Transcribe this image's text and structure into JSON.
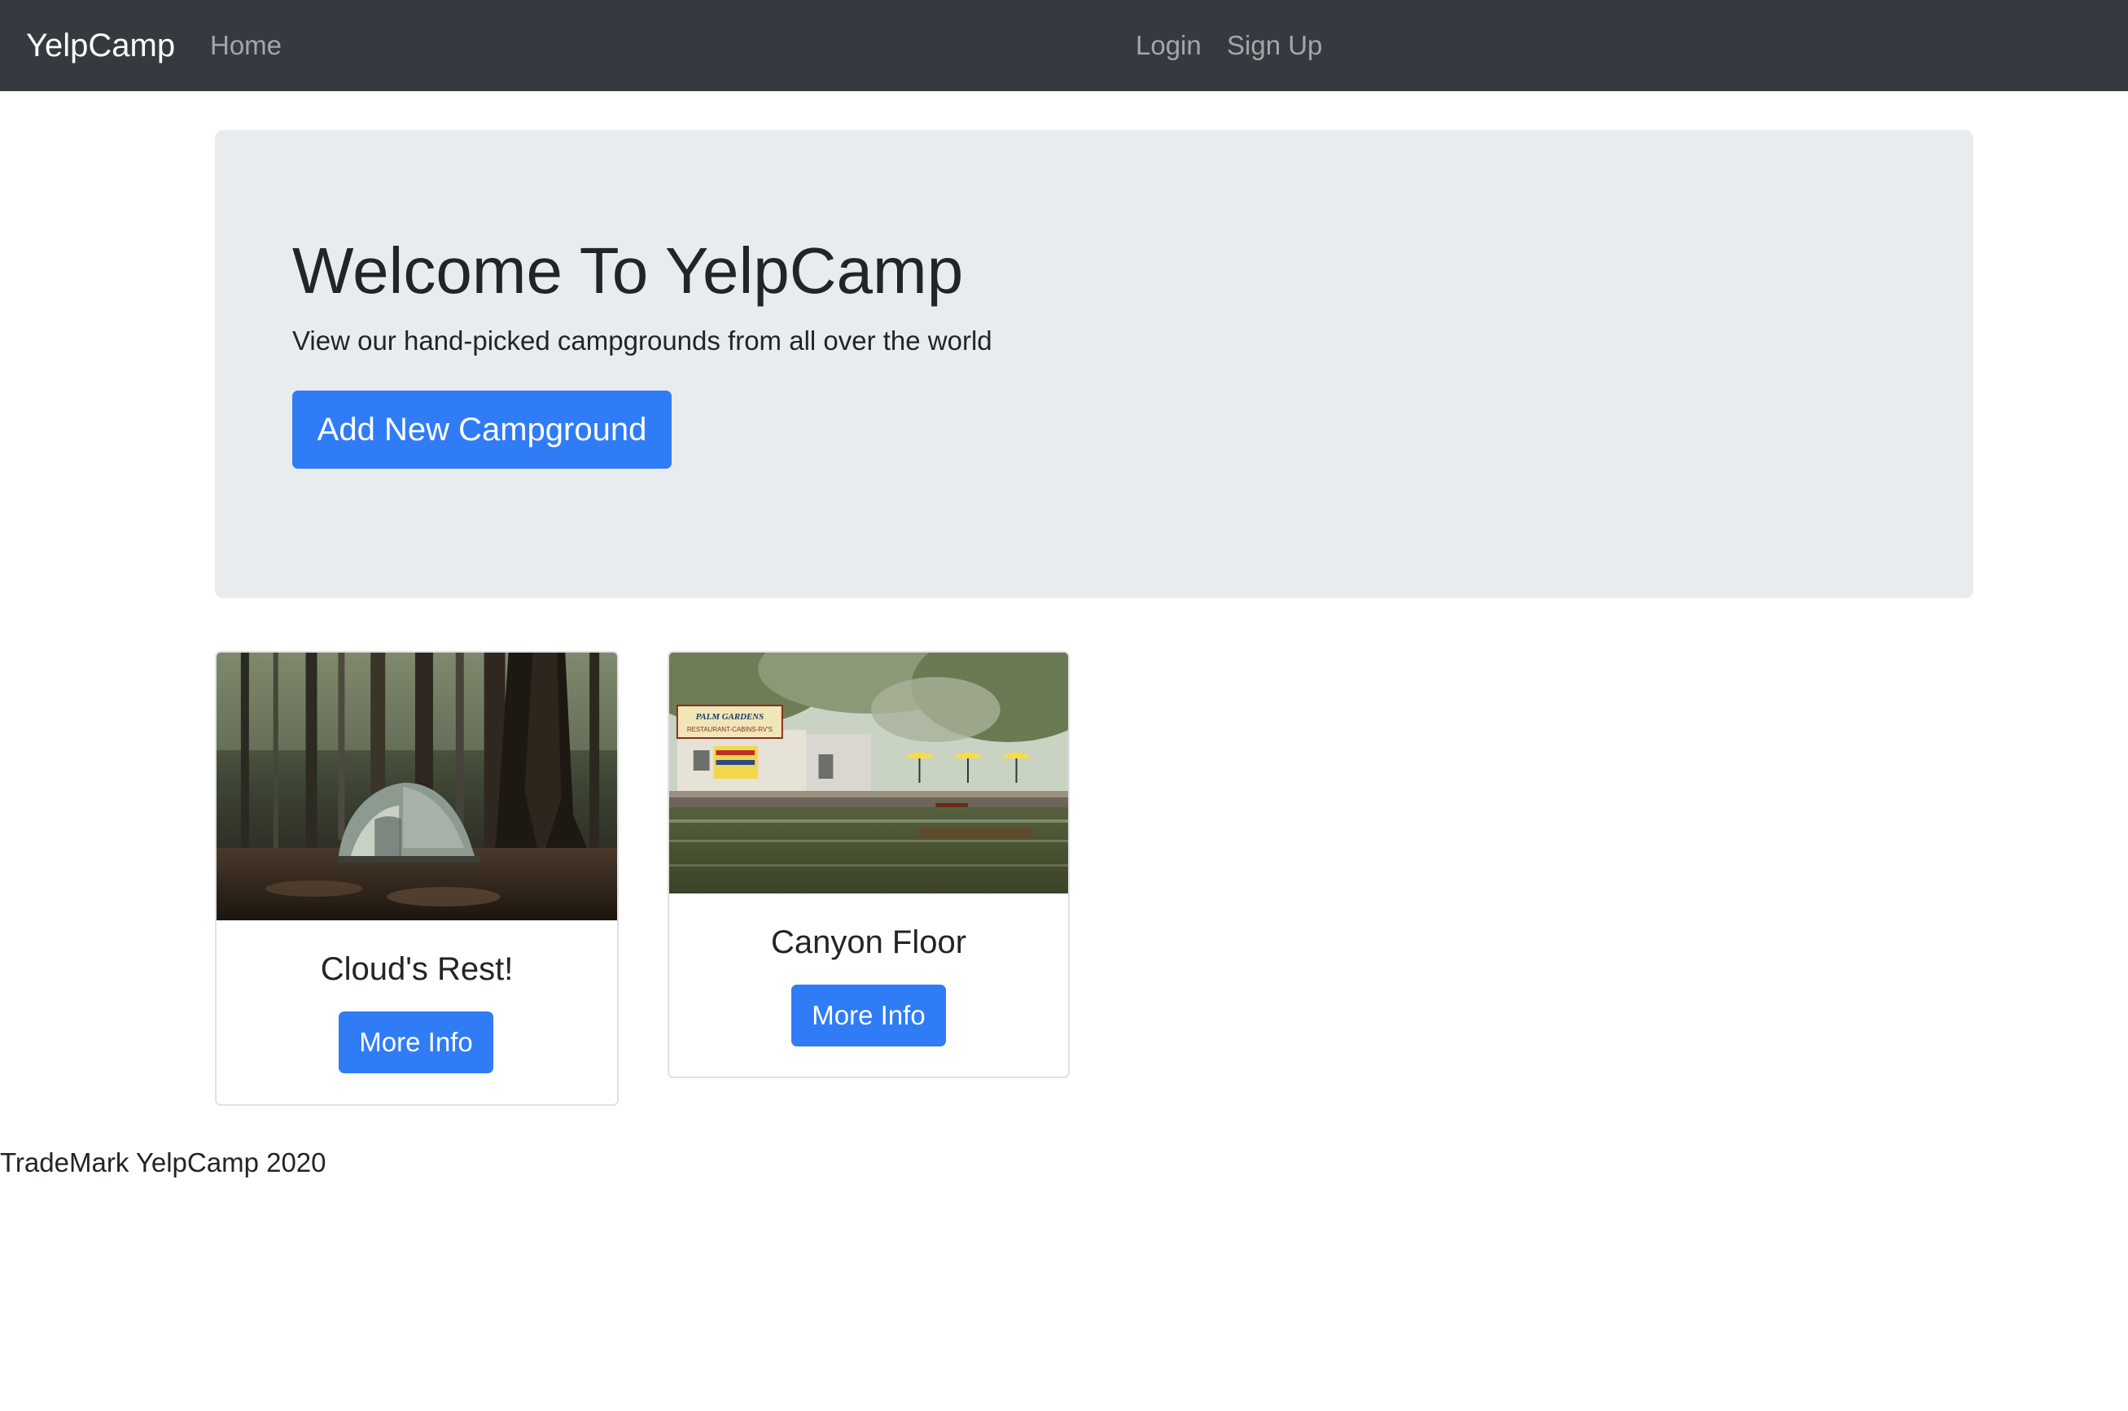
{
  "navbar": {
    "brand": "YelpCamp",
    "home": "Home",
    "login": "Login",
    "signup": "Sign Up"
  },
  "jumbotron": {
    "title": "Welcome To YelpCamp",
    "lead": "View our hand-picked campgrounds from all over the world",
    "add_button": "Add New Campground"
  },
  "campgrounds": [
    {
      "name": "Cloud's Rest!",
      "button": "More Info",
      "image": "tent-in-forest"
    },
    {
      "name": "Canyon Floor",
      "button": "More Info",
      "image": "lakeside-restaurant-dock",
      "sign_text": "PALM GARDENS",
      "sign_subtext": "RESTAURANT-CABINS-RV'S"
    }
  ],
  "footer": {
    "text": "TradeMark YelpCamp 2020"
  },
  "colors": {
    "navbar_bg": "#343a40",
    "jumbotron_bg": "#e9ecef",
    "primary": "#2f7cf6",
    "text": "#212529"
  }
}
